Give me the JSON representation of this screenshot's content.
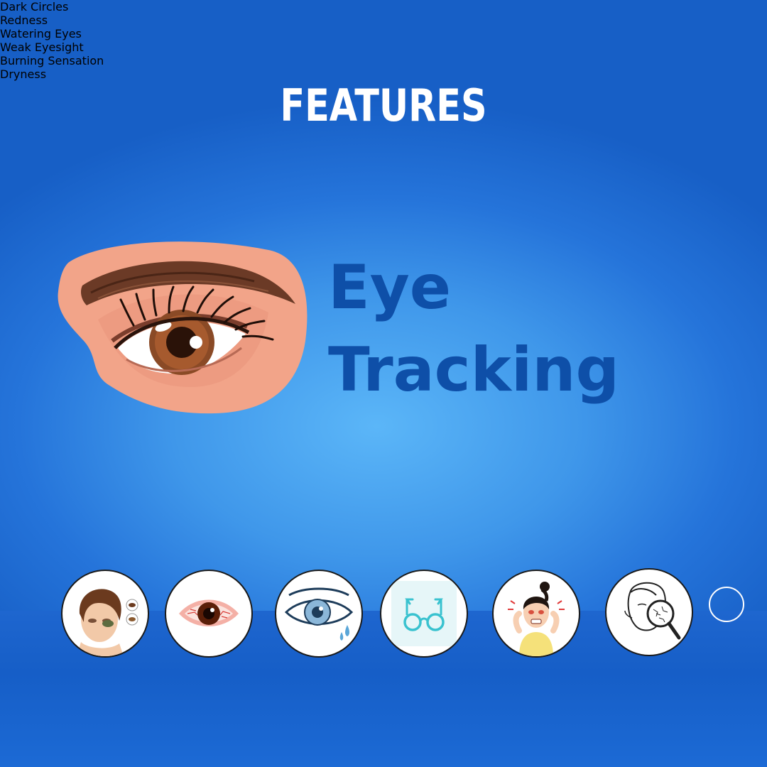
{
  "heading": "FEATURES",
  "feature": {
    "title_line1": "Eye",
    "title_line2": "Tracking",
    "illustration": "eye-closeup-illustration"
  },
  "colors": {
    "background_center": "#5bb6f8",
    "background_edge": "#175fc6",
    "title": "#0e4fa8",
    "label_bg": "#e8101d",
    "label_text": "#ffffff"
  },
  "symptoms": [
    {
      "label": "Dark Circles",
      "icon": "dark-circles-icon"
    },
    {
      "label": "Redness",
      "icon": "red-eye-icon"
    },
    {
      "label": "Watering Eyes",
      "icon": "watering-eye-icon"
    },
    {
      "label": "Weak Eyesight",
      "icon": "glasses-icon"
    },
    {
      "label": "Burning Sensation",
      "icon": "burning-sensation-icon"
    },
    {
      "label": "Dryness",
      "icon": "dry-skin-magnifier-icon"
    }
  ]
}
